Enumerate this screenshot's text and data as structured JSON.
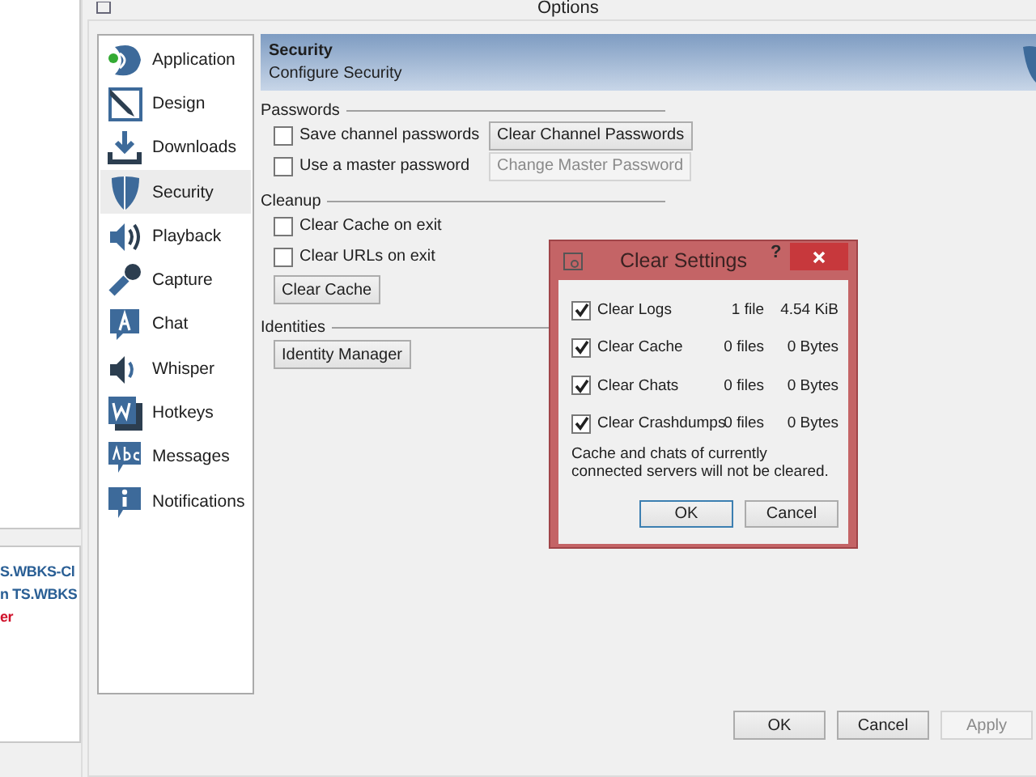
{
  "background_app": {
    "lines": [
      {
        "text": "S.WBKS-Cl",
        "kind": "link"
      },
      {
        "text": "n TS.WBKS",
        "kind": "link"
      },
      {
        "text": "er",
        "kind": "error"
      }
    ]
  },
  "window": {
    "title": "Options"
  },
  "sidebar": {
    "items": [
      {
        "label": "Application",
        "selected": false
      },
      {
        "label": "Design",
        "selected": false
      },
      {
        "label": "Downloads",
        "selected": false
      },
      {
        "label": "Security",
        "selected": true
      },
      {
        "label": "Playback",
        "selected": false
      },
      {
        "label": "Capture",
        "selected": false
      },
      {
        "label": "Chat",
        "selected": false
      },
      {
        "label": "Whisper",
        "selected": false
      },
      {
        "label": "Hotkeys",
        "selected": false
      },
      {
        "label": "Messages",
        "selected": false
      },
      {
        "label": "Notifications",
        "selected": false
      }
    ]
  },
  "header": {
    "title": "Security",
    "subtitle": "Configure Security"
  },
  "groups": [
    {
      "title": "Passwords",
      "rows": [
        {
          "kind": "checkbox",
          "label": "Save channel passwords",
          "checked": false,
          "button": {
            "label": "Clear Channel Passwords",
            "disabled": false
          }
        },
        {
          "kind": "checkbox",
          "label": "Use a master password",
          "checked": false,
          "button": {
            "label": "Change Master Password",
            "disabled": true
          }
        }
      ]
    },
    {
      "title": "Cleanup",
      "rows": [
        {
          "kind": "checkbox",
          "label": "Clear Cache on exit",
          "checked": false
        },
        {
          "kind": "checkbox",
          "label": "Clear URLs on exit",
          "checked": false
        },
        {
          "kind": "button",
          "button": {
            "label": "Clear Cache",
            "disabled": false
          }
        }
      ]
    },
    {
      "title": "Identities",
      "rows": [
        {
          "kind": "button",
          "button": {
            "label": "Identity Manager",
            "disabled": false
          }
        }
      ]
    }
  ],
  "buttons": [
    {
      "label": "OK",
      "disabled": false
    },
    {
      "label": "Cancel",
      "disabled": false
    },
    {
      "label": "Apply",
      "disabled": true
    }
  ],
  "dialog": {
    "title": "Clear Settings",
    "help": "?",
    "items": [
      {
        "label": "Clear Logs",
        "checked": true,
        "count": "1 file",
        "size": "4.54 KiB"
      },
      {
        "label": "Clear Cache",
        "checked": true,
        "count": "0 files",
        "size": "0 Bytes"
      },
      {
        "label": "Clear Chats",
        "checked": true,
        "count": "0 files",
        "size": "0 Bytes"
      },
      {
        "label": "Clear Crashdumps",
        "checked": true,
        "count": "0 files",
        "size": "0 Bytes"
      }
    ],
    "note": "Cache and chats of currently connected servers will not be cleared.",
    "buttons": [
      {
        "label": "OK",
        "default": true
      },
      {
        "label": "Cancel",
        "default": false
      }
    ]
  }
}
